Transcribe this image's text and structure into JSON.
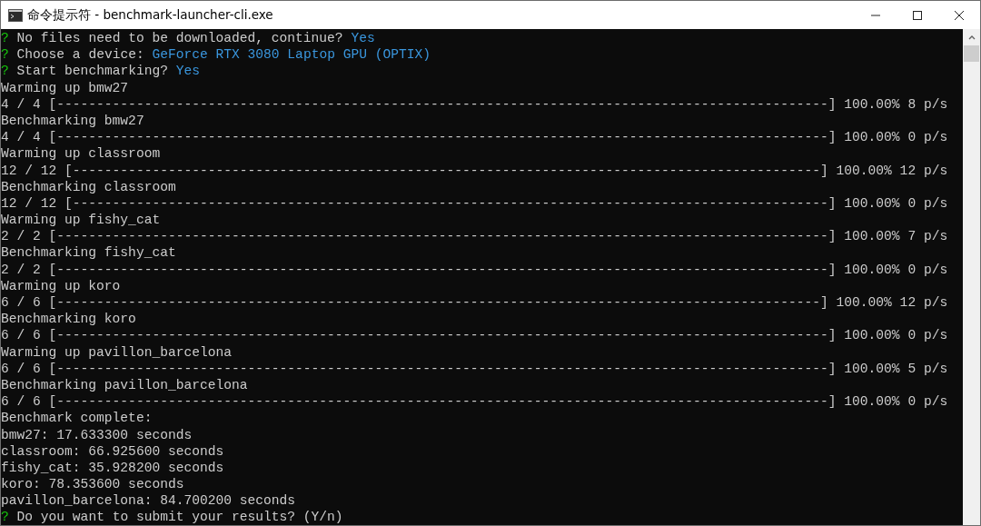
{
  "window": {
    "title": "命令提示符 - benchmark-launcher-cli.exe"
  },
  "lines": [
    {
      "kind": "prompt",
      "mark": "?",
      "question": "No files need to be downloaded, continue?",
      "answer": "Yes"
    },
    {
      "kind": "prompt",
      "mark": "?",
      "question": "Choose a device:",
      "answer": "GeForce RTX 3080 Laptop GPU (OPTIX)"
    },
    {
      "kind": "prompt",
      "mark": "?",
      "question": "Start benchmarking?",
      "answer": "Yes"
    },
    {
      "kind": "text",
      "text": "Warming up bmw27"
    },
    {
      "kind": "text",
      "text": "4 / 4 [-------------------------------------------------------------------------------------------------] 100.00% 8 p/s"
    },
    {
      "kind": "text",
      "text": "Benchmarking bmw27"
    },
    {
      "kind": "text",
      "text": "4 / 4 [-------------------------------------------------------------------------------------------------] 100.00% 0 p/s"
    },
    {
      "kind": "text",
      "text": "Warming up classroom"
    },
    {
      "kind": "text",
      "text": "12 / 12 [----------------------------------------------------------------------------------------------] 100.00% 12 p/s"
    },
    {
      "kind": "text",
      "text": "Benchmarking classroom"
    },
    {
      "kind": "text",
      "text": "12 / 12 [-----------------------------------------------------------------------------------------------] 100.00% 0 p/s"
    },
    {
      "kind": "text",
      "text": "Warming up fishy_cat"
    },
    {
      "kind": "text",
      "text": "2 / 2 [-------------------------------------------------------------------------------------------------] 100.00% 7 p/s"
    },
    {
      "kind": "text",
      "text": "Benchmarking fishy_cat"
    },
    {
      "kind": "text",
      "text": "2 / 2 [-------------------------------------------------------------------------------------------------] 100.00% 0 p/s"
    },
    {
      "kind": "text",
      "text": "Warming up koro"
    },
    {
      "kind": "text",
      "text": "6 / 6 [------------------------------------------------------------------------------------------------] 100.00% 12 p/s"
    },
    {
      "kind": "text",
      "text": "Benchmarking koro"
    },
    {
      "kind": "text",
      "text": "6 / 6 [-------------------------------------------------------------------------------------------------] 100.00% 0 p/s"
    },
    {
      "kind": "text",
      "text": "Warming up pavillon_barcelona"
    },
    {
      "kind": "text",
      "text": "6 / 6 [-------------------------------------------------------------------------------------------------] 100.00% 5 p/s"
    },
    {
      "kind": "text",
      "text": "Benchmarking pavillon_barcelona"
    },
    {
      "kind": "text",
      "text": "6 / 6 [-------------------------------------------------------------------------------------------------] 100.00% 0 p/s"
    },
    {
      "kind": "text",
      "text": "Benchmark complete:"
    },
    {
      "kind": "text",
      "text": "bmw27: 17.633300 seconds"
    },
    {
      "kind": "text",
      "text": "classroom: 66.925600 seconds"
    },
    {
      "kind": "text",
      "text": "fishy_cat: 35.928200 seconds"
    },
    {
      "kind": "text",
      "text": "koro: 78.353600 seconds"
    },
    {
      "kind": "text",
      "text": "pavillon_barcelona: 84.700200 seconds"
    },
    {
      "kind": "prompt",
      "mark": "?",
      "question": "Do you want to submit your results? (Y/n)"
    }
  ]
}
